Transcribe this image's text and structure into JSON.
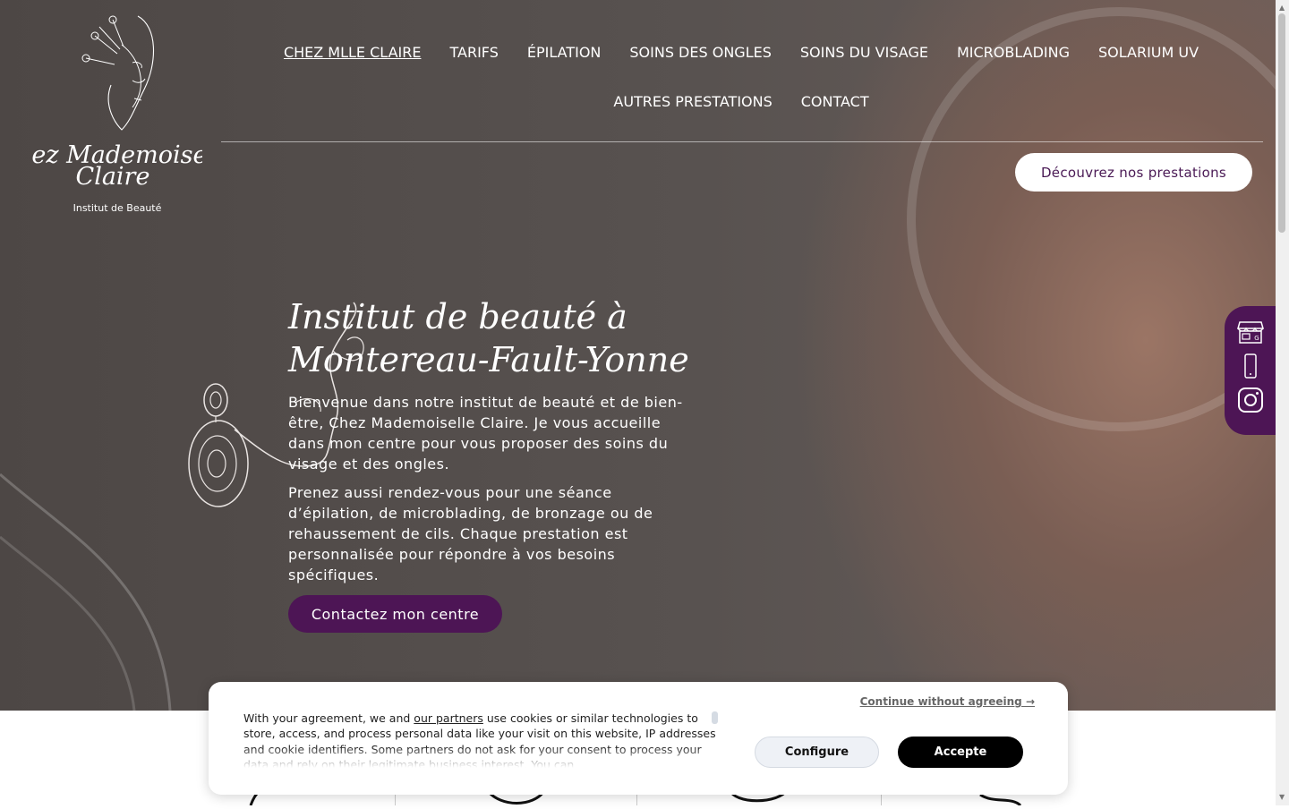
{
  "brand": {
    "logo_line1": "Chez Mademoiselle",
    "logo_line2": "Claire",
    "logo_subtitle": "Institut de Beauté"
  },
  "nav": {
    "items": [
      {
        "label": "CHEZ MLLE CLAIRE",
        "active": true
      },
      {
        "label": "TARIFS"
      },
      {
        "label": "ÉPILATION"
      },
      {
        "label": "SOINS DES ONGLES"
      },
      {
        "label": "SOINS DU VISAGE"
      },
      {
        "label": "MICROBLADING"
      },
      {
        "label": "SOLARIUM UV"
      },
      {
        "label": "AUTRES PRESTATIONS"
      },
      {
        "label": "CONTACT"
      }
    ]
  },
  "header": {
    "cta_label": "Découvrez nos prestations"
  },
  "hero": {
    "title_line1": "Institut de beauté à",
    "title_line2": "Montereau-Fault-Yonne",
    "paragraph1": "Bienvenue dans notre institut de beauté et de bien-être, Chez Mademoiselle Claire. Je vous accueille dans mon centre pour vous proposer des soins du visage et des ongles.",
    "paragraph2": "Prenez aussi rendez-vous pour une séance d’épilation, de microblading, de bronzage ou de rehaussement de cils. Chaque prestation est personnalisée pour répondre à vos besoins spécifiques.",
    "button_label": "Contactez mon centre"
  },
  "side_social": {
    "icons": [
      "store-icon",
      "phone-icon",
      "instagram-icon"
    ]
  },
  "cookie": {
    "continue_label": "Continue without agreeing →",
    "text_before": "With your agreement, we and ",
    "partners_link": "our partners",
    "text_after": " use cookies or similar technologies to store, access, and process personal data like your visit on this website, IP addresses and cookie identifiers. Some partners do not ask for your consent to process your data and rely on their legitimate business interest. You can",
    "configure_label": "Configure",
    "accept_label": "Accepte"
  },
  "colors": {
    "accent_purple": "#4d1555",
    "hero_overlay": "#4d4745",
    "white": "#ffffff"
  }
}
